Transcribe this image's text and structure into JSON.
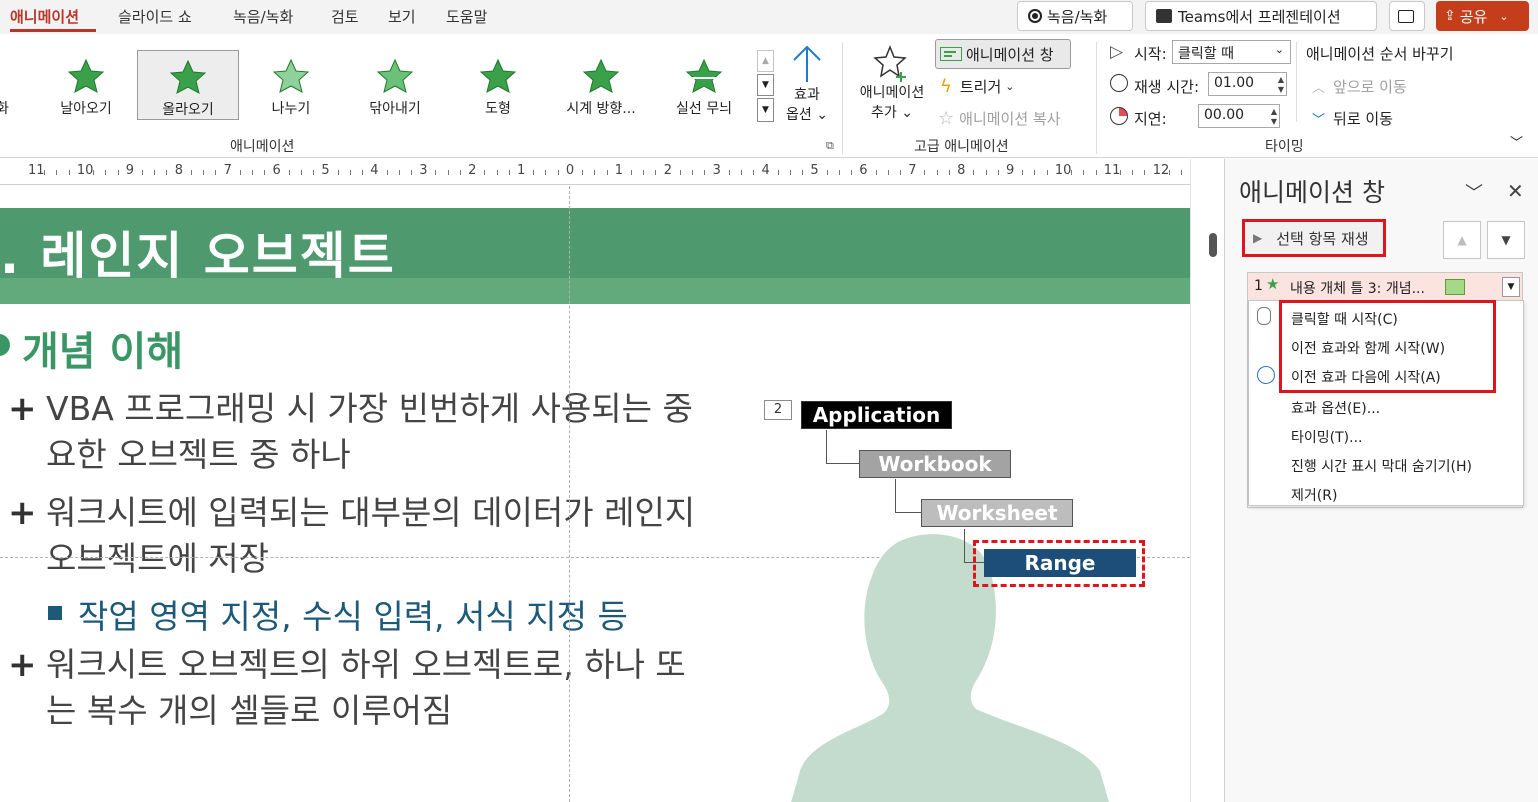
{
  "tabs": [
    {
      "label": "애니메이션",
      "active": true
    },
    {
      "label": "슬라이드 쇼"
    },
    {
      "label": "녹음/녹화"
    },
    {
      "label": "검토"
    },
    {
      "label": "보기"
    },
    {
      "label": "도움말"
    }
  ],
  "top_buttons": {
    "record": "녹음/녹화",
    "teams": "Teams에서 프레젠테이션",
    "share": "공유"
  },
  "colors": {
    "accent_red": "#c43e1c",
    "highlight_red": "#e0141c",
    "slide_green": "#4e9a6e",
    "navy": "#1d4e7a"
  },
  "ribbon": {
    "gallery": [
      {
        "label": "화"
      },
      {
        "label": "날아오기"
      },
      {
        "label": "올라오기",
        "selected": true
      },
      {
        "label": "나누기"
      },
      {
        "label": "닦아내기"
      },
      {
        "label": "도형"
      },
      {
        "label": "시계 방향..."
      },
      {
        "label": "실선 무늬"
      }
    ],
    "effect_options": [
      "효과",
      "옵션"
    ],
    "group_animation": "애니메이션",
    "add_animation": [
      "애니메이션",
      "추가"
    ],
    "animation_pane_btn": "애니메이션 창",
    "trigger_btn": "트리거",
    "copy_animation": "애니메이션 복사",
    "group_advanced": "고급 애니메이션",
    "start_label": "시작:",
    "start_value": "클릭할 때",
    "duration_label": "재생 시간:",
    "duration_value": "01.00",
    "delay_label": "지연:",
    "delay_value": "00.00",
    "group_timing": "타이밍",
    "reorder_title": "애니메이션 순서 바꾸기",
    "move_earlier": "앞으로 이동",
    "move_later": "뒤로 이동"
  },
  "ruler": [
    "11",
    "10",
    "9",
    "8",
    "7",
    "6",
    "5",
    "4",
    "3",
    "2",
    "1",
    "0",
    "1",
    "2",
    "3",
    "4",
    "5",
    "6",
    "7",
    "8",
    "9",
    "10",
    "11",
    "12"
  ],
  "slide": {
    "title": ". 레인지 오브젝트",
    "section": "개념 이해",
    "bullets": [
      {
        "lines": [
          "VBA 프로그래밍 시 가장 빈번하게 사용되는 중",
          "요한 오브젝트 중 하나"
        ]
      },
      {
        "lines": [
          "워크시트에 입력되는 대부분의 데이터가 레인지",
          "오브젝트에 저장"
        ]
      },
      {
        "lines": [
          "워크시트 오브젝트의 하위 오브젝트로, 하나 또",
          "는 복수 개의 셀들로 이루어짐"
        ]
      }
    ],
    "sub_bullet": "작업 영역 지정, 수식 입력, 서식 지정 등",
    "anim_badge": "2",
    "hierarchy": [
      "Application",
      "Workbook",
      "Worksheet",
      "Range"
    ]
  },
  "pane": {
    "title": "애니메이션 창",
    "play_selected": "선택 항목 재생",
    "item": {
      "number": "1",
      "label": "내용 개체 틀 3: 개념..."
    },
    "menu": [
      "클릭할 때 시작(C)",
      "이전 효과와 함께 시작(W)",
      "이전 효과 다음에 시작(A)",
      "효과 옵션(E)...",
      "타이밍(T)...",
      "진행 시간 표시 막대 숨기기(H)",
      "제거(R)"
    ]
  }
}
